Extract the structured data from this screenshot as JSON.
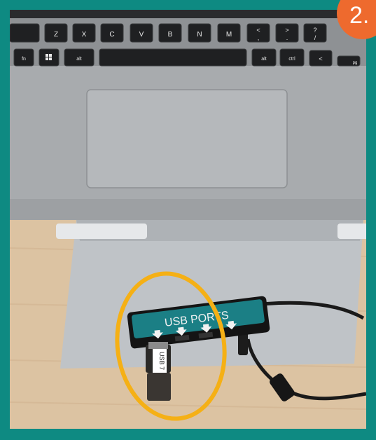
{
  "step_badge": {
    "label": "2."
  },
  "keyboard": {
    "row1": [
      "Z",
      "X",
      "C",
      "V",
      "B",
      "N",
      "M",
      "<",
      ">",
      "?"
    ],
    "row1_sub": [
      ",",
      ".",
      "/"
    ],
    "row2": [
      "fn",
      "alt",
      "alt",
      "ctrl",
      "<"
    ],
    "pgdn": "pg"
  },
  "hub": {
    "label": "USB PORTS"
  },
  "usb_drive": {
    "label": "USB 7"
  },
  "colors": {
    "frame": "#0e8a82",
    "badge": "#ee6a2e",
    "highlight_circle": "#f5b015",
    "hub_panel": "#1b7f85"
  }
}
